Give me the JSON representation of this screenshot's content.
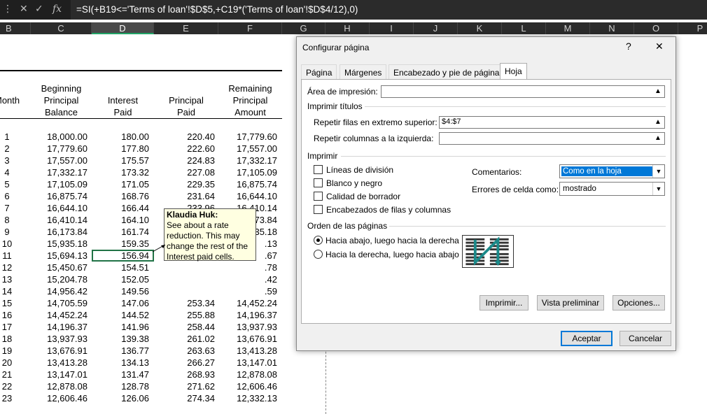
{
  "formula_bar": {
    "icon_more": "⋮",
    "icon_cancel": "✕",
    "icon_enter": "✓",
    "icon_fx": "fx",
    "formula": "=SI(+B19<='Terms of loan'!$D$5,+C19*('Terms of loan'!$D$4/12),0)"
  },
  "columns": [
    "B",
    "C",
    "D",
    "E",
    "F",
    "G",
    "H",
    "I",
    "J",
    "K",
    "L",
    "M",
    "N",
    "O",
    "P"
  ],
  "headers": {
    "month": "Month",
    "beginning": [
      "Beginning",
      "Principal",
      "Balance"
    ],
    "interest": [
      "Interest",
      "Paid"
    ],
    "principal": [
      "Principal",
      "Paid"
    ],
    "remaining": [
      "Remaining",
      "Principal",
      "Amount"
    ]
  },
  "rows": [
    {
      "m": "1",
      "c": "18,000.00",
      "d": "180.00",
      "e": "220.40",
      "f": "17,779.60"
    },
    {
      "m": "2",
      "c": "17,779.60",
      "d": "177.80",
      "e": "222.60",
      "f": "17,557.00"
    },
    {
      "m": "3",
      "c": "17,557.00",
      "d": "175.57",
      "e": "224.83",
      "f": "17,332.17"
    },
    {
      "m": "4",
      "c": "17,332.17",
      "d": "173.32",
      "e": "227.08",
      "f": "17,105.09"
    },
    {
      "m": "5",
      "c": "17,105.09",
      "d": "171.05",
      "e": "229.35",
      "f": "16,875.74"
    },
    {
      "m": "6",
      "c": "16,875.74",
      "d": "168.76",
      "e": "231.64",
      "f": "16,644.10"
    },
    {
      "m": "7",
      "c": "16,644.10",
      "d": "166.44",
      "e": "233.96",
      "f": "16,410.14"
    },
    {
      "m": "8",
      "c": "16,410.14",
      "d": "164.10",
      "e": "236.30",
      "f": "16,173.84"
    },
    {
      "m": "9",
      "c": "16,173.84",
      "d": "161.74",
      "e": "238.66",
      "f": "15,935.18"
    },
    {
      "m": "10",
      "c": "15,935.18",
      "d": "159.35",
      "e": "",
      "f": ".13"
    },
    {
      "m": "11",
      "c": "15,694.13",
      "d": "156.94",
      "e": "",
      "f": ".67"
    },
    {
      "m": "12",
      "c": "15,450.67",
      "d": "154.51",
      "e": "",
      "f": ".78"
    },
    {
      "m": "13",
      "c": "15,204.78",
      "d": "152.05",
      "e": "",
      "f": ".42"
    },
    {
      "m": "14",
      "c": "14,956.42",
      "d": "149.56",
      "e": "",
      "f": ".59"
    },
    {
      "m": "15",
      "c": "14,705.59",
      "d": "147.06",
      "e": "253.34",
      "f": "14,452.24"
    },
    {
      "m": "16",
      "c": "14,452.24",
      "d": "144.52",
      "e": "255.88",
      "f": "14,196.37"
    },
    {
      "m": "17",
      "c": "14,196.37",
      "d": "141.96",
      "e": "258.44",
      "f": "13,937.93"
    },
    {
      "m": "18",
      "c": "13,937.93",
      "d": "139.38",
      "e": "261.02",
      "f": "13,676.91"
    },
    {
      "m": "19",
      "c": "13,676.91",
      "d": "136.77",
      "e": "263.63",
      "f": "13,413.28"
    },
    {
      "m": "20",
      "c": "13,413.28",
      "d": "134.13",
      "e": "266.27",
      "f": "13,147.01"
    },
    {
      "m": "21",
      "c": "13,147.01",
      "d": "131.47",
      "e": "268.93",
      "f": "12,878.08"
    },
    {
      "m": "22",
      "c": "12,878.08",
      "d": "128.78",
      "e": "271.62",
      "f": "12,606.46"
    },
    {
      "m": "23",
      "c": "12,606.46",
      "d": "126.06",
      "e": "274.34",
      "f": "12,332.13"
    }
  ],
  "comment": {
    "author": "Klaudia Huk:",
    "text": "See about a rate reduction. This may change the rest of the Interest paid cells."
  },
  "dialog": {
    "title": "Configurar página",
    "help": "?",
    "close": "✕",
    "tabs": [
      "Página",
      "Márgenes",
      "Encabezado y pie de página",
      "Hoja"
    ],
    "print_area_label": "Área de impresión:",
    "print_area_value": "",
    "print_titles_label": "Imprimir títulos",
    "rows_repeat_label": "Repetir filas en extremo superior:",
    "rows_repeat_value": "$4:$7",
    "cols_repeat_label": "Repetir columnas a la izquierda:",
    "cols_repeat_value": "",
    "print_label": "Imprimir",
    "checkboxes": [
      "Líneas de división",
      "Blanco y negro",
      "Calidad de borrador",
      "Encabezados de filas y columnas"
    ],
    "comments_label": "Comentarios:",
    "comments_value": "Como en la hoja",
    "errors_label": "Errores de celda como:",
    "errors_value": "mostrado",
    "order_label": "Orden de las páginas",
    "order_down": "Hacia abajo, luego hacia la derecha",
    "order_over": "Hacia la derecha, luego hacia abajo",
    "btn_print": "Imprimir...",
    "btn_preview": "Vista preliminar",
    "btn_options": "Opciones...",
    "btn_ok": "Aceptar",
    "btn_cancel": "Cancelar"
  }
}
